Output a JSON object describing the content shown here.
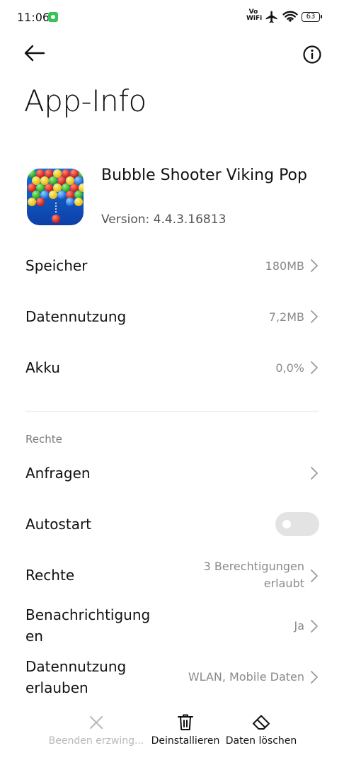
{
  "status_bar": {
    "time": "11:06",
    "network_label_top": "Vo",
    "network_label_bottom": "WiFi",
    "battery": "63"
  },
  "header": {
    "title": "App-Info",
    "back_icon": "arrow-left-icon",
    "info_icon": "info-circle-icon"
  },
  "app": {
    "name": "Bubble Shooter Viking Pop",
    "version": "Version: 4.4.3.16813"
  },
  "usage_rows": [
    {
      "label": "Speicher",
      "value": "180MB"
    },
    {
      "label": "Datennutzung",
      "value": "7,2MB"
    },
    {
      "label": "Akku",
      "value": "0,0%"
    }
  ],
  "permissions_section": {
    "header": "Rechte",
    "requests_label": "Anfragen",
    "autostart_label": "Autostart",
    "autostart_enabled": false,
    "rights_label": "Rechte",
    "rights_value_line1": "3 Berechtigungen",
    "rights_value_line2": "erlaubt",
    "notifications_label_line1": "Benachrichtigung",
    "notifications_label_line2": "en",
    "notifications_value": "Ja",
    "data_usage_label_line1": "Datennutzung",
    "data_usage_label_line2": "erlauben",
    "data_usage_value": "WLAN, Mobile Daten"
  },
  "bottom_actions": [
    {
      "label": "Beenden erzwing...",
      "icon": "close-x-icon",
      "enabled": false
    },
    {
      "label": "Deinstallieren",
      "icon": "trash-icon",
      "enabled": true
    },
    {
      "label": "Daten löschen",
      "icon": "eraser-icon",
      "enabled": true
    }
  ],
  "colors": {
    "text_primary": "#111111",
    "text_secondary": "#8a8a8a",
    "toggle_off": "#e3e3e3",
    "disabled": "#b8b8b8"
  }
}
